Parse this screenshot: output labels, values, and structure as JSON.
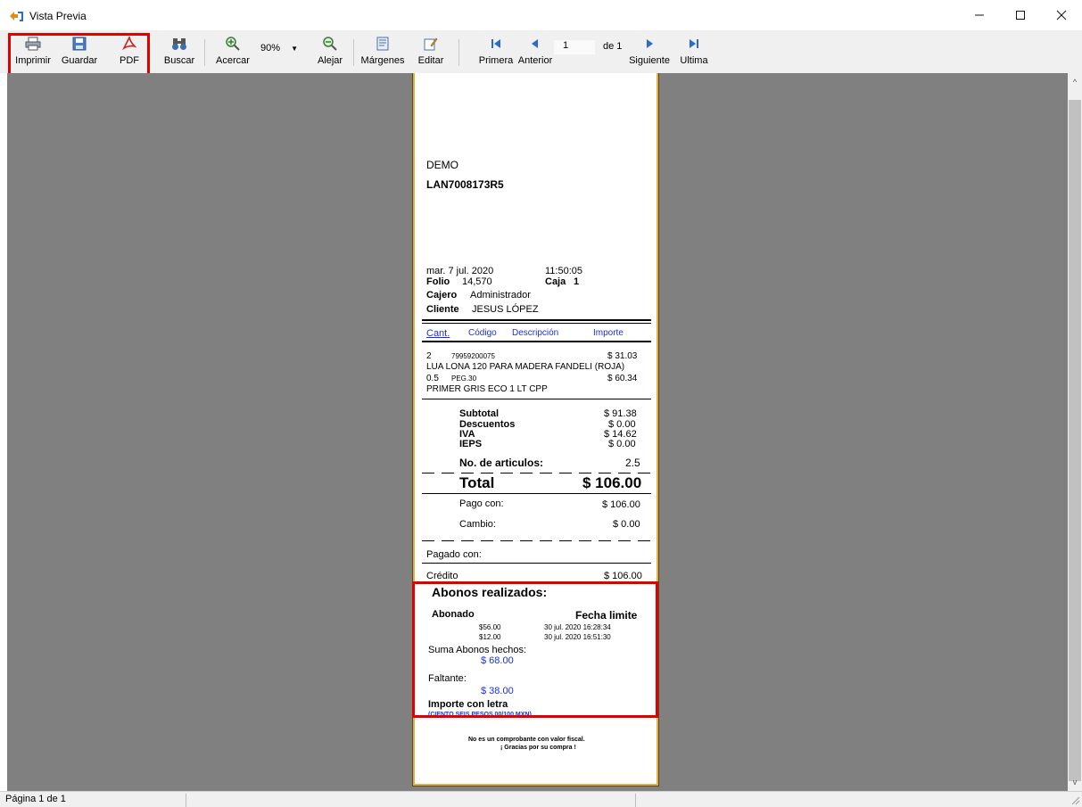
{
  "window": {
    "title": "Vista Previa"
  },
  "toolbar": {
    "print_label": "Imprimir",
    "save_label": "Guardar",
    "pdf_label": "PDF",
    "search_label": "Buscar",
    "zoom_in_label": "Acercar",
    "zoom_value": "90%",
    "zoom_out_label": "Alejar",
    "margins_label": "Márgenes",
    "edit_label": "Editar",
    "first_label": "Primera",
    "prev_label": "Anterior",
    "page_value": "1",
    "page_total_label": "de 1",
    "next_label": "Siguiente",
    "last_label": "Ultima"
  },
  "ticket": {
    "company": "DEMO",
    "rfc": "LAN7008173R5",
    "date": "mar. 7 jul. 2020",
    "time": "11:50:05",
    "folio_label": "Folio",
    "folio_value": "14,570",
    "caja_label": "Caja",
    "caja_value": "1",
    "cajero_label": "Cajero",
    "cajero_value": "Administrador",
    "cliente_label": "Cliente",
    "cliente_value": "JESUS LÓPEZ",
    "headers": {
      "cant": "Cant.",
      "codigo": "Código",
      "descripcion": "Descripción",
      "importe": "Importe"
    },
    "items": [
      {
        "qty": "2",
        "code": "79959200075",
        "price": "$ 31.03",
        "desc": "LUA LONA 120 PARA MADERA FANDELI (ROJA)"
      },
      {
        "qty": "0.5",
        "code": "PEG.30",
        "price": "$ 60.34",
        "desc": "PRIMER GRIS ECO 1 LT CPP"
      }
    ],
    "subtotal_label": "Subtotal",
    "subtotal_value": "$ 91.38",
    "descuentos_label": "Descuentos",
    "descuentos_value": "$ 0.00",
    "iva_label": "IVA",
    "iva_value": "$ 14.62",
    "ieps_label": "IEPS",
    "ieps_value": "$ 0.00",
    "articulos_label": "No. de articulos:",
    "articulos_value": "2.5",
    "total_label": "Total",
    "total_value": "$ 106.00",
    "pago_label": "Pago con:",
    "pago_value": "$ 106.00",
    "cambio_label": "Cambio:",
    "cambio_value": "$ 0.00",
    "pagado_label": "Pagado con:",
    "credito_label": "Crédito",
    "credito_value": "$ 106.00",
    "abonos_title": "Abonos realizados:",
    "abonado_header": "Abonado",
    "fecha_header": "Fecha limite",
    "abonos": [
      {
        "amount": "$56.00",
        "date": "30 jul. 2020 16:28:34"
      },
      {
        "amount": "$12.00",
        "date": "30 jul. 2020 16:51:30"
      }
    ],
    "suma_label": "Suma Abonos hechos:",
    "suma_value": "$ 68.00",
    "faltante_label": "Faltante:",
    "faltante_value": "$ 38.00",
    "importe_letra_label": "Importe con letra",
    "importe_letra_value": "(CIENTO SEIS PESOS 00/100 MXN)",
    "footer_1": "No es un comprobante con valor fiscal.",
    "footer_2": "¡ Gracias por su compra !"
  },
  "status": {
    "page_info": "Página 1 de 1"
  },
  "colors": {
    "highlight": "#e00000",
    "preview_bg": "#808080",
    "ticket_border": "#e0b040",
    "link_blue": "#1a30d8"
  }
}
